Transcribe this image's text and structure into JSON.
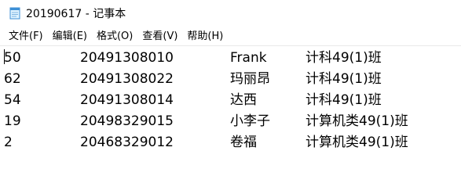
{
  "window": {
    "title": "20190617 - 记事本",
    "icon": "notepad-icon"
  },
  "menu": [
    {
      "label": "文件(F)"
    },
    {
      "label": "编辑(E)"
    },
    {
      "label": "格式(O)"
    },
    {
      "label": "查看(V)"
    },
    {
      "label": "帮助(H)"
    }
  ],
  "content": {
    "rows": [
      {
        "id": "50",
        "number": "20491308010",
        "name": "Frank",
        "class": "计科49(1)班"
      },
      {
        "id": "62",
        "number": "20491308022",
        "name": "玛丽昂",
        "class": "计科49(1)班"
      },
      {
        "id": "54",
        "number": "20491308014",
        "name": "达西",
        "class": "计科49(1)班"
      },
      {
        "id": "19",
        "number": "20498329015",
        "name": "小李子",
        "class": "计算机类49(1)班"
      },
      {
        "id": "2",
        "number": "20468329012",
        "name": "卷福",
        "class": "计算机类49(1)班"
      }
    ]
  }
}
